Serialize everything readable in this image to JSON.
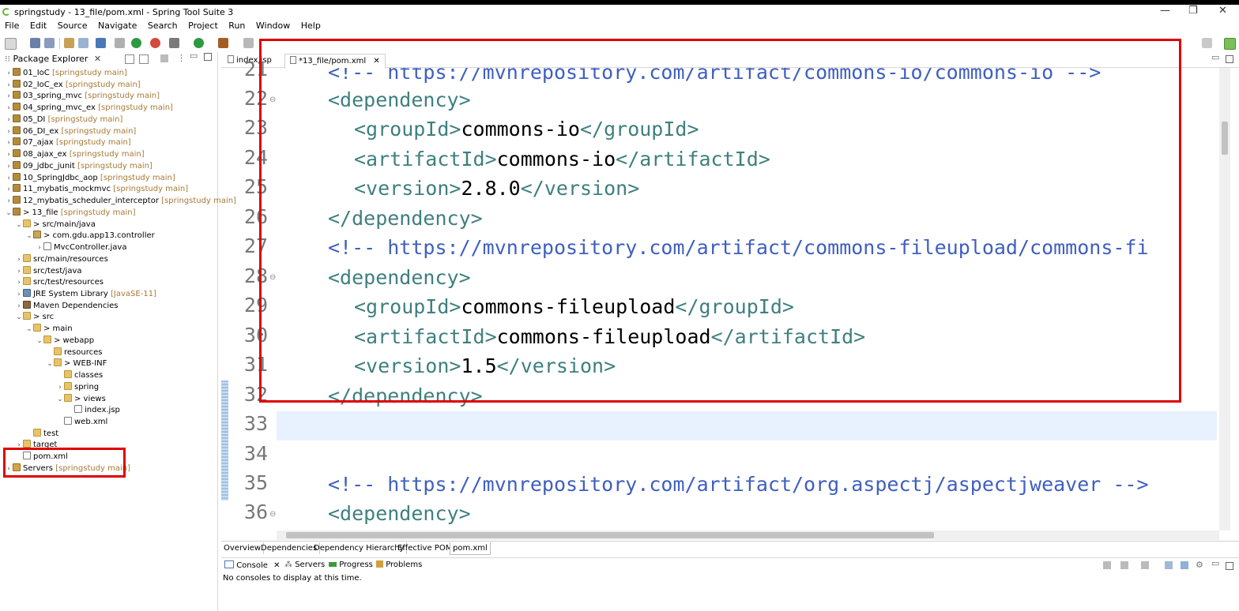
{
  "window": {
    "title": "springstudy - 13_file/pom.xml - Spring Tool Suite 3",
    "minimize": "—",
    "restore": "❐",
    "close": "✕"
  },
  "menu": [
    "File",
    "Edit",
    "Source",
    "Navigate",
    "Search",
    "Project",
    "Run",
    "Window",
    "Help"
  ],
  "package_explorer": {
    "tab_label": "Package Explorer",
    "items": [
      {
        "label": "01_IoC",
        "dec": "[springstudy main]"
      },
      {
        "label": "02_IoC_ex",
        "dec": "[springstudy main]"
      },
      {
        "label": "03_spring_mvc",
        "dec": "[springstudy main]"
      },
      {
        "label": "04_spring_mvc_ex",
        "dec": "[springstudy main]"
      },
      {
        "label": "05_DI",
        "dec": "[springstudy main]"
      },
      {
        "label": "06_DI_ex",
        "dec": "[springstudy main]"
      },
      {
        "label": "07_ajax",
        "dec": "[springstudy main]"
      },
      {
        "label": "08_ajax_ex",
        "dec": "[springstudy main]"
      },
      {
        "label": "09_jdbc_junit",
        "dec": "[springstudy main]"
      },
      {
        "label": "10_SpringJdbc_aop",
        "dec": "[springstudy main]"
      },
      {
        "label": "11_mybatis_mockmvc",
        "dec": "[springstudy main]"
      },
      {
        "label": "12_mybatis_scheduler_interceptor",
        "dec": "[springstudy main]"
      },
      {
        "label": "> 13_file",
        "dec": "[springstudy main]"
      },
      {
        "label": "> src/main/java",
        "dec": ""
      },
      {
        "label": "> com.gdu.app13.controller",
        "dec": ""
      },
      {
        "label": "MvcController.java",
        "dec": ""
      },
      {
        "label": "src/main/resources",
        "dec": ""
      },
      {
        "label": "src/test/java",
        "dec": ""
      },
      {
        "label": "src/test/resources",
        "dec": ""
      },
      {
        "label": "JRE System Library",
        "dec": "[JavaSE-11]"
      },
      {
        "label": "Maven Dependencies",
        "dec": ""
      },
      {
        "label": "> src",
        "dec": ""
      },
      {
        "label": "> main",
        "dec": ""
      },
      {
        "label": "> webapp",
        "dec": ""
      },
      {
        "label": "resources",
        "dec": ""
      },
      {
        "label": "> WEB-INF",
        "dec": ""
      },
      {
        "label": "classes",
        "dec": ""
      },
      {
        "label": "spring",
        "dec": ""
      },
      {
        "label": "> views",
        "dec": ""
      },
      {
        "label": "index.jsp",
        "dec": ""
      },
      {
        "label": "web.xml",
        "dec": ""
      },
      {
        "label": "test",
        "dec": ""
      },
      {
        "label": "target",
        "dec": ""
      },
      {
        "label": "pom.xml",
        "dec": ""
      },
      {
        "label": "Servers",
        "dec": "[springstudy main]"
      }
    ]
  },
  "editor": {
    "tabs": [
      {
        "label": "index.jsp"
      },
      {
        "label": "*13_file/pom.xml"
      }
    ],
    "line_numbers": [
      "21",
      "22",
      "23",
      "24",
      "25",
      "26",
      "27",
      "28",
      "29",
      "30",
      "31",
      "32",
      "33",
      "34",
      "35",
      "36"
    ],
    "lines": {
      "l21": "<!-- https://mvnrepository.com/artifact/commons-io/commons-io -->",
      "l22": "<dependency>",
      "l23_open": "<groupId>",
      "l23_val": "commons-io",
      "l23_close": "</groupId>",
      "l24_open": "<artifactId>",
      "l24_val": "commons-io",
      "l24_close": "</artifactId>",
      "l25_open": "<version>",
      "l25_val": "2.8.0",
      "l25_close": "</version>",
      "l26": "</dependency>",
      "l27": "<!-- https://mvnrepository.com/artifact/commons-fileupload/commons-fi",
      "l28": "<dependency>",
      "l29_open": "<groupId>",
      "l29_val": "commons-fileupload",
      "l29_close": "</groupId>",
      "l30_open": "<artifactId>",
      "l30_val": "commons-fileupload",
      "l30_close": "</artifactId>",
      "l31_open": "<version>",
      "l31_val": "1.5",
      "l31_close": "</version>",
      "l32": "</dependency>",
      "l35": "<!-- https://mvnrepository.com/artifact/org.aspectj/aspectjweaver -->",
      "l36": "<dependency>"
    },
    "bottom_tabs": [
      "Overview",
      "Dependencies",
      "Dependency Hierarchy",
      "Effective POM",
      "pom.xml"
    ]
  },
  "console": {
    "tabs": [
      "Console",
      "Servers",
      "Progress",
      "Problems"
    ],
    "message": "No consoles to display at this time."
  },
  "colors": {
    "highlight": "#e00000",
    "xml_tag": "#3f7f7f",
    "xml_comment": "#3f5fbf"
  }
}
